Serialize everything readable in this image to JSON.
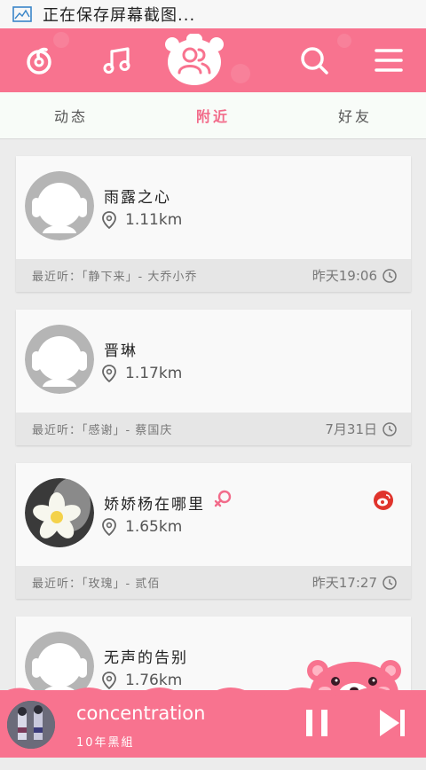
{
  "status_bar": {
    "text": "正在保存屏幕截图..."
  },
  "tabs": [
    {
      "label": "动态",
      "active": false
    },
    {
      "label": "附近",
      "active": true
    },
    {
      "label": "好友",
      "active": false
    }
  ],
  "colors": {
    "accent": "#f8738f",
    "active_tab": "#f26b8a"
  },
  "cards": [
    {
      "name": "雨露之心",
      "distance": "1.11km",
      "recent": "最近听：「静下来」- 大乔小乔",
      "time": "昨天19:06",
      "avatar": "default"
    },
    {
      "name": "晋琳",
      "distance": "1.17km",
      "recent": "最近听：「感谢」- 蔡国庆",
      "time": "7月31日",
      "avatar": "default"
    },
    {
      "name": "娇娇杨在哪里",
      "distance": "1.65km",
      "recent": "最近听：「玫瑰」- 贰佰",
      "time": "昨天17:27",
      "avatar": "flower",
      "gender": "female",
      "weibo": true
    },
    {
      "name": "无声的告别",
      "distance": "1.76km",
      "avatar": "default"
    }
  ],
  "player": {
    "song": "concentration",
    "artist": "10年黑組"
  }
}
